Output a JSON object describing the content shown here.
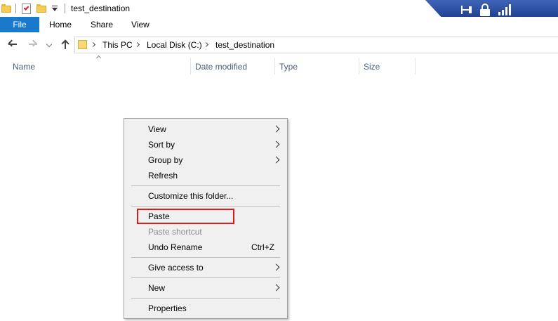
{
  "window": {
    "title": "test_destination"
  },
  "ribbon": {
    "file_label": "File",
    "tabs": [
      {
        "label": "Home"
      },
      {
        "label": "Share"
      },
      {
        "label": "View"
      }
    ]
  },
  "address": {
    "crumbs": [
      "This PC",
      "Local Disk (C:)",
      "test_destination"
    ]
  },
  "columns": [
    {
      "label": "Name"
    },
    {
      "label": "Date modified"
    },
    {
      "label": "Type"
    },
    {
      "label": "Size"
    }
  ],
  "context_menu": {
    "items": [
      {
        "label": "View",
        "submenu": true
      },
      {
        "label": "Sort by",
        "submenu": true
      },
      {
        "label": "Group by",
        "submenu": true
      },
      {
        "label": "Refresh"
      },
      {
        "label": "Customize this folder..."
      },
      {
        "label": "Paste",
        "highlighted": true
      },
      {
        "label": "Paste shortcut",
        "disabled": true
      },
      {
        "label": "Undo Rename",
        "shortcut": "Ctrl+Z"
      },
      {
        "label": "Give access to",
        "submenu": true
      },
      {
        "label": "New",
        "submenu": true
      },
      {
        "label": "Properties"
      }
    ]
  },
  "colors": {
    "accent": "#1979ca",
    "highlight_outline": "#e01b1b",
    "remote_bar": "#2a4da0"
  },
  "icons": {
    "qat": [
      "folder-icon",
      "properties-icon",
      "new-folder-icon",
      "customize-qat-icon"
    ],
    "remote_bar": [
      "pin-icon",
      "lock-icon",
      "signal-icon"
    ],
    "nav": [
      "back-arrow-icon",
      "forward-arrow-icon",
      "recent-locations-icon",
      "up-arrow-icon"
    ]
  }
}
